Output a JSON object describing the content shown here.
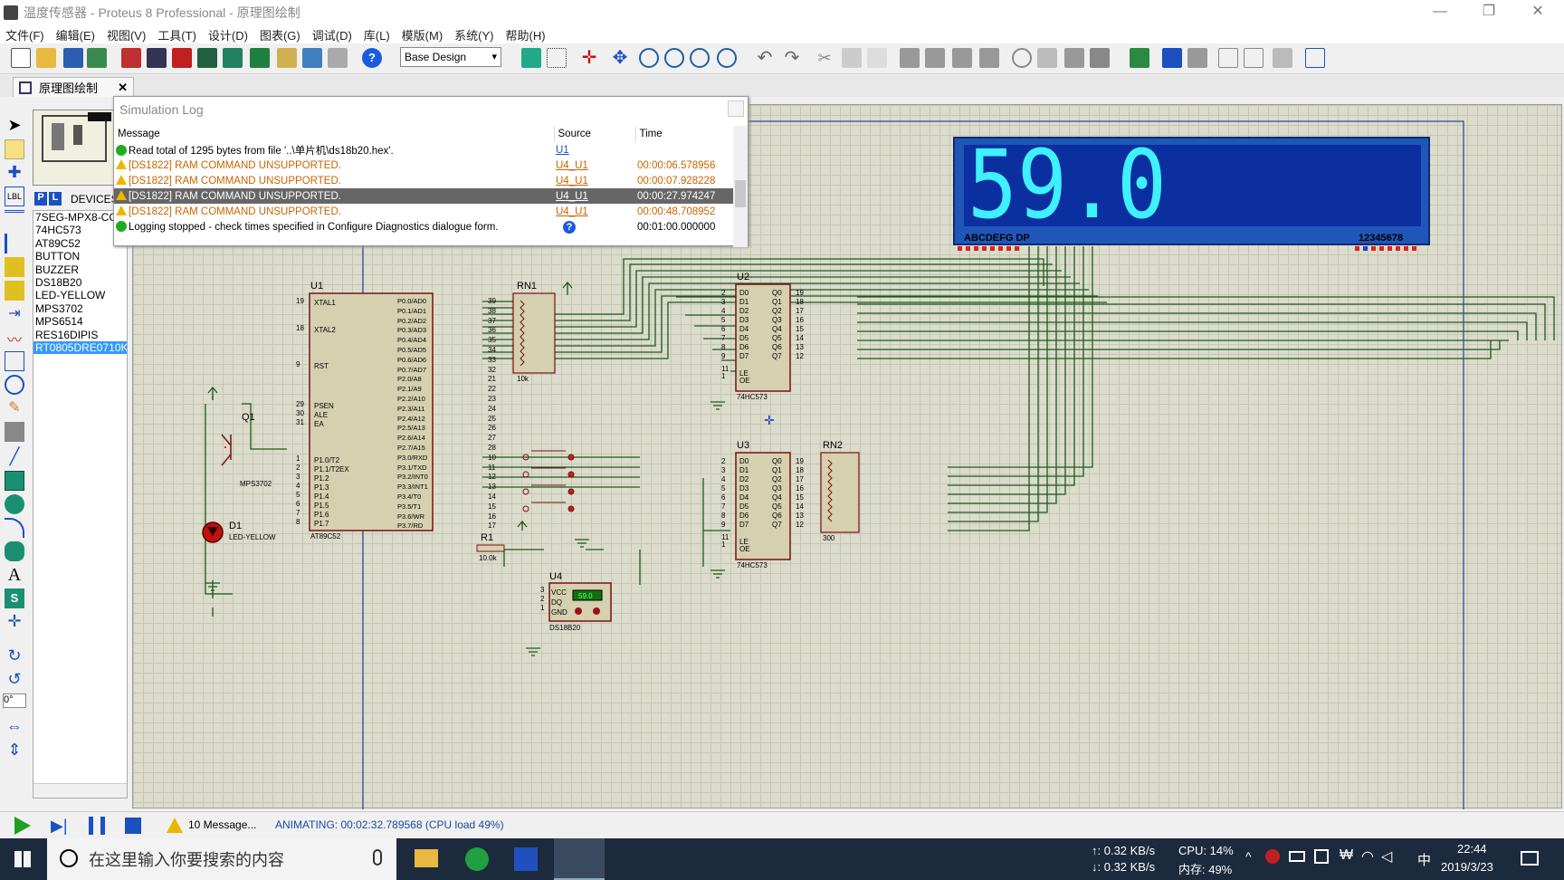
{
  "window": {
    "title": "温度传感器 - Proteus 8 Professional - 原理图绘制"
  },
  "menu": [
    "文件(F)",
    "编辑(E)",
    "视图(V)",
    "工具(T)",
    "设计(D)",
    "图表(G)",
    "调试(D)",
    "库(L)",
    "模版(M)",
    "系统(Y)",
    "帮助(H)"
  ],
  "toolbar": {
    "design_select": "Base Design"
  },
  "tab": {
    "label": "原理图绘制"
  },
  "devices": {
    "header_p": "P",
    "header_l": "L",
    "header_label": "DEVICES",
    "items": [
      "7SEG-MPX8-CC-BLUE",
      "74HC573",
      "AT89C52",
      "BUTTON",
      "BUZZER",
      "DS18B20",
      "LED-YELLOW",
      "MPS3702",
      "MPS6514",
      "RES16DIPIS",
      "RT0805DRE0710KL"
    ],
    "selected_index": 10
  },
  "rotation": "0°",
  "log": {
    "title": "Simulation Log",
    "columns": [
      "Message",
      "Source",
      "Time"
    ],
    "rows": [
      {
        "type": "info",
        "message": "Read total of 1295 bytes from file '..\\单片机\\ds18b20.hex'.",
        "source": "U1",
        "time": ""
      },
      {
        "type": "warn",
        "message": "[DS1822] RAM COMMAND UNSUPPORTED.",
        "source": "U4_U1",
        "time": "00:00:06.578956"
      },
      {
        "type": "warn",
        "message": "[DS1822] RAM COMMAND UNSUPPORTED.",
        "source": "U4_U1",
        "time": "00:00:07.928228"
      },
      {
        "type": "warn",
        "message": "[DS1822] RAM COMMAND UNSUPPORTED.",
        "source": "U4_U1",
        "time": "00:00:27.974247",
        "selected": true
      },
      {
        "type": "warn",
        "message": "[DS1822] RAM COMMAND UNSUPPORTED.",
        "source": "U4_U1",
        "time": "00:00:48.708952"
      },
      {
        "type": "info",
        "message": "Logging stopped - check times specified in Configure Diagnostics dialogue form.",
        "source": "?",
        "time": "00:01:00.000000"
      }
    ]
  },
  "schematic": {
    "display_digits": "59.0",
    "display_left_label": "ABCDEFG DP",
    "display_right_label": "12345678",
    "u1": {
      "ref": "U1",
      "part": "AT89C52",
      "left_pins": [
        {
          "n": "19",
          "name": "XTAL1"
        },
        {
          "n": "18",
          "name": "XTAL2"
        },
        {
          "n": "9",
          "name": "RST"
        },
        {
          "n": "29",
          "name": "PSEN"
        },
        {
          "n": "30",
          "name": "ALE"
        },
        {
          "n": "31",
          "name": "EA"
        },
        {
          "n": "1",
          "name": "P1.0/T2"
        },
        {
          "n": "2",
          "name": "P1.1/T2EX"
        },
        {
          "n": "3",
          "name": "P1.2"
        },
        {
          "n": "4",
          "name": "P1.3"
        },
        {
          "n": "5",
          "name": "P1.4"
        },
        {
          "n": "6",
          "name": "P1.5"
        },
        {
          "n": "7",
          "name": "P1.6"
        },
        {
          "n": "8",
          "name": "P1.7"
        }
      ],
      "right_pins": [
        {
          "n": "39",
          "name": "P0.0/AD0"
        },
        {
          "n": "38",
          "name": "P0.1/AD1"
        },
        {
          "n": "37",
          "name": "P0.2/AD2"
        },
        {
          "n": "36",
          "name": "P0.3/AD3"
        },
        {
          "n": "35",
          "name": "P0.4/AD4"
        },
        {
          "n": "34",
          "name": "P0.5/AD5"
        },
        {
          "n": "33",
          "name": "P0.6/AD6"
        },
        {
          "n": "32",
          "name": "P0.7/AD7"
        },
        {
          "n": "21",
          "name": "P2.0/A8"
        },
        {
          "n": "22",
          "name": "P2.1/A9"
        },
        {
          "n": "23",
          "name": "P2.2/A10"
        },
        {
          "n": "24",
          "name": "P2.3/A11"
        },
        {
          "n": "25",
          "name": "P2.4/A12"
        },
        {
          "n": "26",
          "name": "P2.5/A13"
        },
        {
          "n": "27",
          "name": "P2.6/A14"
        },
        {
          "n": "28",
          "name": "P2.7/A15"
        },
        {
          "n": "10",
          "name": "P3.0/RXD"
        },
        {
          "n": "11",
          "name": "P3.1/TXD"
        },
        {
          "n": "12",
          "name": "P3.2/INT0"
        },
        {
          "n": "13",
          "name": "P3.3/INT1"
        },
        {
          "n": "14",
          "name": "P3.4/T0"
        },
        {
          "n": "15",
          "name": "P3.5/T1"
        },
        {
          "n": "16",
          "name": "P3.6/WR"
        },
        {
          "n": "17",
          "name": "P3.7/RD"
        }
      ]
    },
    "u2": {
      "ref": "U2",
      "part": "74HC573"
    },
    "u3": {
      "ref": "U3",
      "part": "74HC573"
    },
    "latch_in": [
      "D0",
      "D1",
      "D2",
      "D3",
      "D4",
      "D5",
      "D6",
      "D7"
    ],
    "latch_out": [
      "Q0",
      "Q1",
      "Q2",
      "Q3",
      "Q4",
      "Q5",
      "Q6",
      "Q7"
    ],
    "latch_in_nums": [
      "2",
      "3",
      "4",
      "5",
      "6",
      "7",
      "8",
      "9"
    ],
    "latch_out_nums": [
      "19",
      "18",
      "17",
      "16",
      "15",
      "14",
      "13",
      "12"
    ],
    "latch_le": "LE",
    "latch_oe": "OE",
    "latch_le_n": "11",
    "latch_oe_n": "1",
    "rn1": {
      "ref": "RN1",
      "value": "10k"
    },
    "rn2": {
      "ref": "RN2",
      "value": "300"
    },
    "r1": {
      "ref": "R1",
      "value": "10.0k"
    },
    "q1": {
      "ref": "Q1",
      "part": "MPS3702"
    },
    "d1": {
      "ref": "D1",
      "part": "LED-YELLOW"
    },
    "u4": {
      "ref": "U4",
      "part": "DS18B20",
      "reading": "59.0",
      "pins": [
        "VCC",
        "DQ",
        "GND"
      ],
      "pin_nums": [
        "3",
        "2",
        "1"
      ]
    }
  },
  "status": {
    "messages": "10 Message...",
    "animating": "ANIMATING: 00:02:32.789568 (CPU load 49%)"
  },
  "taskbar": {
    "search_placeholder": "在这里输入你要搜索的内容",
    "net_up": "↑: 0.32 KB/s",
    "net_down": "↓: 0.32 KB/s",
    "cpu": "CPU: 14%",
    "mem": "内存: 49%",
    "ime": "中",
    "time": "22:44",
    "date": "2019/3/23"
  }
}
